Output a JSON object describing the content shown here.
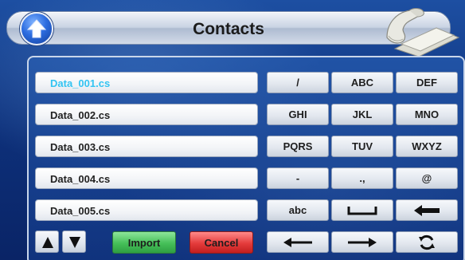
{
  "header": {
    "title": "Contacts",
    "up_icon": "up-arrow-icon",
    "contact_icon": "phone-book-icon"
  },
  "files": [
    {
      "name": "Data_001.cs",
      "selected": true
    },
    {
      "name": "Data_002.cs",
      "selected": false
    },
    {
      "name": "Data_003.cs",
      "selected": false
    },
    {
      "name": "Data_004.cs",
      "selected": false
    },
    {
      "name": "Data_005.cs",
      "selected": false
    }
  ],
  "keypad": {
    "row1": [
      "/",
      "ABC",
      "DEF"
    ],
    "row2": [
      "GHI",
      "JKL",
      "MNO"
    ],
    "row3": [
      "PQRS",
      "TUV",
      "WXYZ"
    ],
    "row4": [
      "-",
      ".,",
      "@"
    ],
    "row5": [
      "abc",
      "space-icon",
      "backspace-icon"
    ],
    "row6": [
      "cursor-left-icon",
      "cursor-right-icon",
      "refresh-icon"
    ]
  },
  "controls": {
    "import_label": "Import",
    "cancel_label": "Cancel",
    "scroll_up_icon": "triangle-up-icon",
    "scroll_down_icon": "triangle-down-icon"
  },
  "colors": {
    "selected_text": "#33c4f2",
    "import": "#45bf58",
    "cancel": "#e43b3b",
    "background": "#0d2f78"
  }
}
